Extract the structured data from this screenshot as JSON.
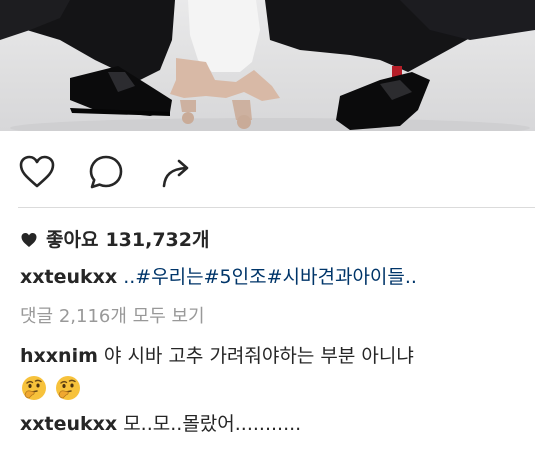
{
  "post": {
    "likes_label": "좋아요",
    "likes_count": "131,732개",
    "caption": {
      "username": "xxteukxx",
      "text": "..#우리는#5인조#시바견과아이들.."
    },
    "view_comments_label": "댓글 2,116개 모두 보기",
    "comments": [
      {
        "username": "hxxnim",
        "text": "야 시바 고추 가려줘야하는 부분 아니냐",
        "emojis": [
          "thinking-face",
          "thinking-face"
        ]
      },
      {
        "username": "xxteukxx",
        "text": "모..모..몰랐어..........."
      }
    ]
  },
  "icons": {
    "like": "heart-outline-icon",
    "comment": "speech-bubble-icon",
    "share": "share-arrow-icon",
    "likes_heart": "heart-filled-icon"
  },
  "colors": {
    "text": "#262626",
    "hashtag": "#003569",
    "muted": "#999999",
    "divider": "#dbdbdb"
  }
}
